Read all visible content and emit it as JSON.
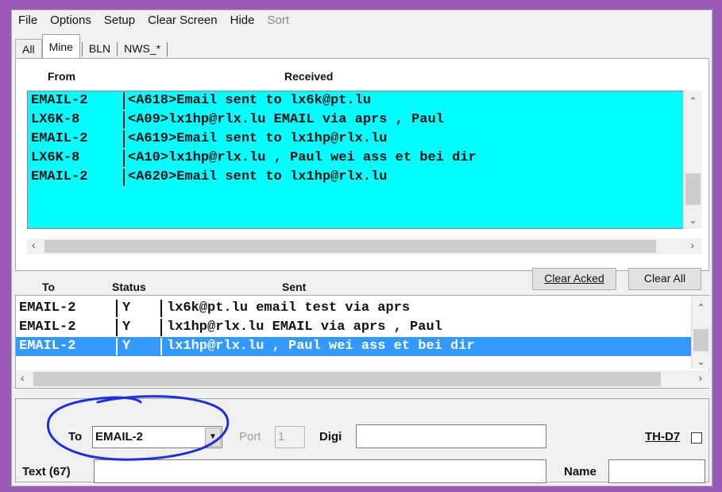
{
  "menu": [
    "File",
    "Options",
    "Setup",
    "Clear Screen",
    "Hide",
    "Sort"
  ],
  "tabs": [
    "All",
    "Mine",
    "BLN",
    "NWS_*"
  ],
  "received": {
    "headers": {
      "from": "From",
      "received": "Received"
    },
    "rows": [
      {
        "from": "EMAIL-2",
        "text": "<A618>Email sent to lx6k@pt.lu"
      },
      {
        "from": "LX6K-8",
        "text": "<A09>lx1hp@rlx.lu EMAIL via aprs , Paul"
      },
      {
        "from": "EMAIL-2",
        "text": "<A619>Email sent to lx1hp@rlx.lu"
      },
      {
        "from": "LX6K-8",
        "text": "<A10>lx1hp@rlx.lu , Paul wei ass et bei dir"
      },
      {
        "from": "EMAIL-2",
        "text": "<A620>Email sent to lx1hp@rlx.lu"
      }
    ],
    "background": "#00ffff"
  },
  "sent": {
    "headers": {
      "to": "To",
      "status": "Status",
      "sent": "Sent"
    },
    "buttons": {
      "clear_acked": "Clear Acked",
      "clear_all": "Clear All"
    },
    "rows": [
      {
        "to": "EMAIL-2",
        "status": "Y",
        "text": "lx6k@pt.lu email test via aprs"
      },
      {
        "to": "EMAIL-2",
        "status": "Y",
        "text": "lx1hp@rlx.lu EMAIL via aprs , Paul"
      },
      {
        "to": "EMAIL-2",
        "status": "Y",
        "text": "lx1hp@rlx.lu , Paul wei ass et bei dir"
      }
    ],
    "selection_color": "#3399ff"
  },
  "compose": {
    "to_label": "To",
    "to_value": "EMAIL-2",
    "port_label": "Port",
    "port_value": "1",
    "digi_label": "Digi",
    "digi_value": "",
    "thd7_label": "TH-D7",
    "text_label": "Text (67)",
    "text_value": "",
    "name_label": "Name",
    "name_value": ""
  },
  "annotation_color": "#1a2ee8"
}
